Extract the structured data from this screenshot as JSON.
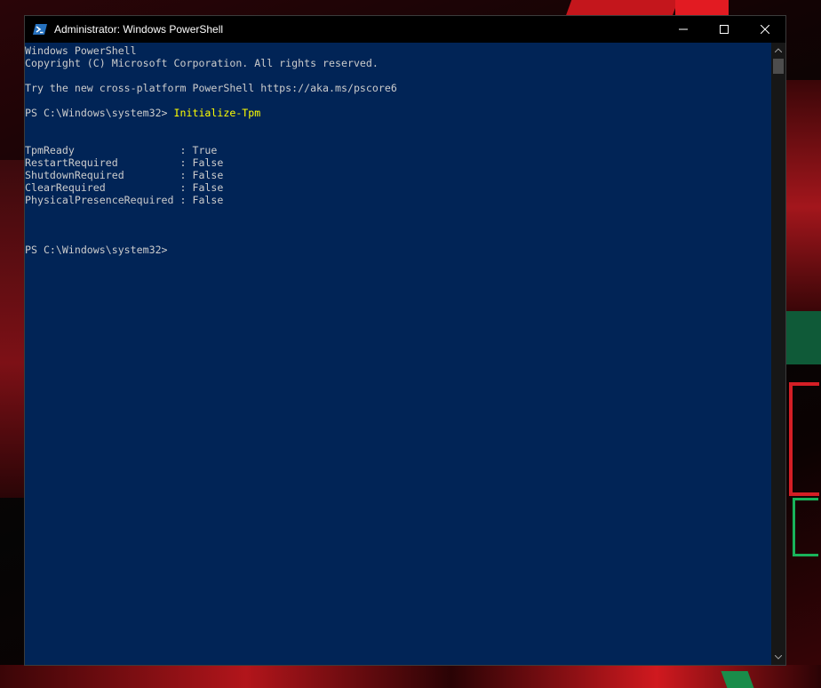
{
  "window": {
    "title": "Administrator: Windows PowerShell",
    "icon": "powershell-icon",
    "controls": {
      "minimize": "minimize-icon",
      "maximize": "maximize-icon",
      "close": "close-icon"
    }
  },
  "console": {
    "lines": [
      {
        "text": "Windows PowerShell"
      },
      {
        "text": "Copyright (C) Microsoft Corporation. All rights reserved."
      },
      {
        "text": ""
      },
      {
        "text": "Try the new cross-platform PowerShell https://aka.ms/pscore6"
      },
      {
        "text": ""
      },
      {
        "prompt": "PS C:\\Windows\\system32> ",
        "command": "Initialize-Tpm"
      },
      {
        "text": ""
      },
      {
        "text": ""
      },
      {
        "text": "TpmReady                 : True"
      },
      {
        "text": "RestartRequired          : False"
      },
      {
        "text": "ShutdownRequired         : False"
      },
      {
        "text": "ClearRequired            : False"
      },
      {
        "text": "PhysicalPresenceRequired : False"
      },
      {
        "text": ""
      },
      {
        "text": ""
      },
      {
        "text": ""
      },
      {
        "text": "PS C:\\Windows\\system32>"
      }
    ]
  },
  "colors": {
    "console_bg": "#012456",
    "console_fg": "#cccccc",
    "command_fg": "#ffff00",
    "titlebar_bg": "#000000"
  }
}
